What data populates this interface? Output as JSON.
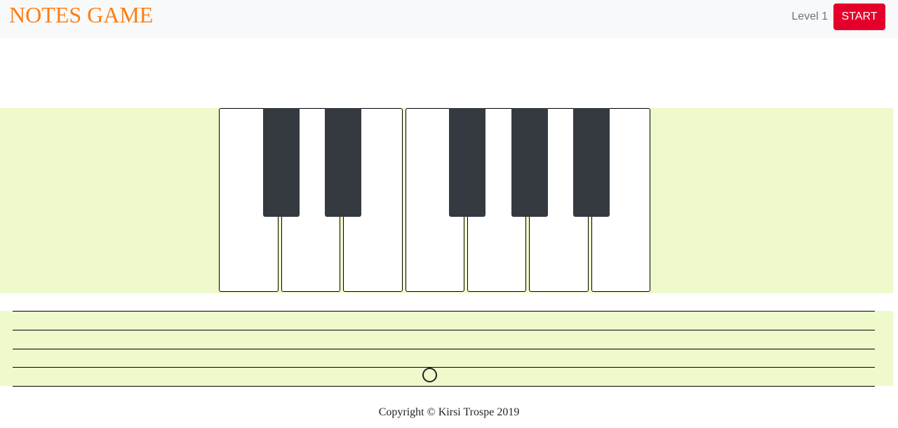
{
  "header": {
    "brand": "NOTES GAME",
    "level": "Level 1",
    "start_label": "START"
  },
  "colors": {
    "brand": "#fd7e14",
    "start_button": "#e4002b",
    "band": "#effacc",
    "black_key": "#343a40"
  },
  "keyboard": {
    "white_keys": [
      "C",
      "D",
      "E",
      "F",
      "G",
      "A",
      "B"
    ],
    "black_keys": [
      "C#",
      "D#",
      "F#",
      "G#",
      "A#"
    ]
  },
  "staff": {
    "line_count": 5,
    "note_shape": "whole-note-circle"
  },
  "footer": {
    "copyright": "Copyright © Kirsi Trospe 2019"
  }
}
